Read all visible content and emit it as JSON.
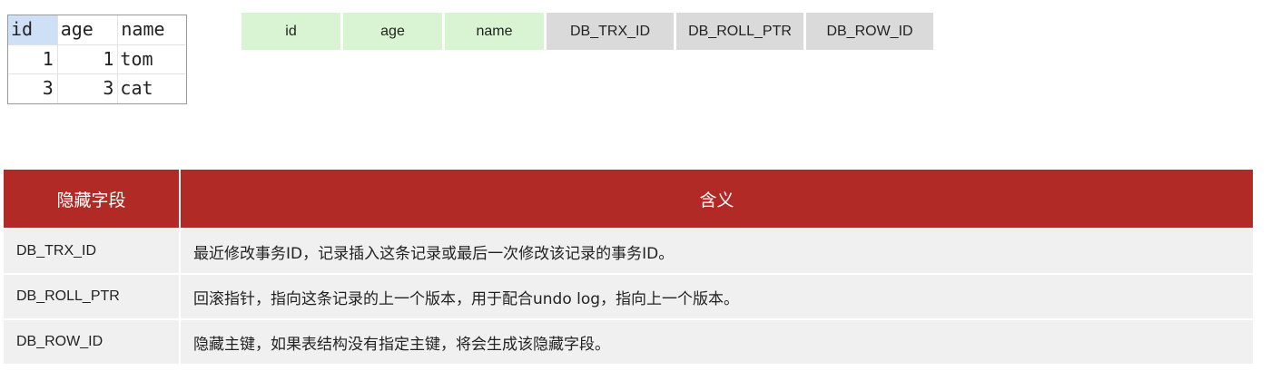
{
  "result_grid": {
    "columns": [
      "id",
      "age",
      "name"
    ],
    "rows": [
      [
        "1",
        "1",
        "tom"
      ],
      [
        "3",
        "3",
        "cat"
      ]
    ]
  },
  "row_structure": {
    "user_columns": [
      "id",
      "age",
      "name"
    ],
    "hidden_columns": [
      "DB_TRX_ID",
      "DB_ROLL_PTR",
      "DB_ROW_ID"
    ]
  },
  "hidden_fields_table": {
    "header": {
      "field": "隐藏字段",
      "meaning": "含义"
    },
    "rows": [
      {
        "field": "DB_TRX_ID",
        "meaning": "最近修改事务ID，记录插入这条记录或最后一次修改该记录的事务ID。"
      },
      {
        "field": "DB_ROLL_PTR",
        "meaning": "回滚指针，指向这条记录的上一个版本，用于配合undo log，指向上一个版本。"
      },
      {
        "field": "DB_ROW_ID",
        "meaning": "隐藏主键，如果表结构没有指定主键，将会生成该隐藏字段。"
      }
    ]
  },
  "colors": {
    "header_red": "#b12a26",
    "user_column_green": "#d9f4d2",
    "hidden_column_gray": "#dadada",
    "row_bg": "#f0f0f0",
    "selected_header_blue": "#cde0f5"
  }
}
